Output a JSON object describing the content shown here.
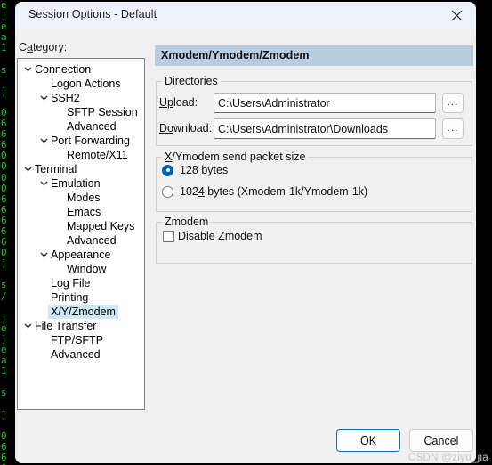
{
  "window": {
    "title": "Session Options - Default",
    "close_icon": "close-icon"
  },
  "category": {
    "label_pre": "C",
    "label_accel": "a",
    "label_post": "tegory:",
    "tree": [
      {
        "label": "Connection",
        "indent": 0,
        "expander": "chevron-down",
        "selected": false
      },
      {
        "label": "Logon Actions",
        "indent": 1,
        "expander": "none",
        "selected": false
      },
      {
        "label": "SSH2",
        "indent": 1,
        "expander": "chevron-down",
        "selected": false
      },
      {
        "label": "SFTP Session",
        "indent": 2,
        "expander": "none",
        "selected": false
      },
      {
        "label": "Advanced",
        "indent": 2,
        "expander": "none",
        "selected": false
      },
      {
        "label": "Port Forwarding",
        "indent": 1,
        "expander": "chevron-down",
        "selected": false
      },
      {
        "label": "Remote/X11",
        "indent": 2,
        "expander": "none",
        "selected": false
      },
      {
        "label": "Terminal",
        "indent": 0,
        "expander": "chevron-down",
        "selected": false
      },
      {
        "label": "Emulation",
        "indent": 1,
        "expander": "chevron-down",
        "selected": false
      },
      {
        "label": "Modes",
        "indent": 2,
        "expander": "none",
        "selected": false
      },
      {
        "label": "Emacs",
        "indent": 2,
        "expander": "none",
        "selected": false
      },
      {
        "label": "Mapped Keys",
        "indent": 2,
        "expander": "none",
        "selected": false
      },
      {
        "label": "Advanced",
        "indent": 2,
        "expander": "none",
        "selected": false
      },
      {
        "label": "Appearance",
        "indent": 1,
        "expander": "chevron-down",
        "selected": false
      },
      {
        "label": "Window",
        "indent": 2,
        "expander": "none",
        "selected": false
      },
      {
        "label": "Log File",
        "indent": 1,
        "expander": "none",
        "selected": false
      },
      {
        "label": "Printing",
        "indent": 1,
        "expander": "none",
        "selected": false
      },
      {
        "label": "X/Y/Zmodem",
        "indent": 1,
        "expander": "none",
        "selected": true
      },
      {
        "label": "File Transfer",
        "indent": 0,
        "expander": "chevron-down",
        "selected": false
      },
      {
        "label": "FTP/SFTP",
        "indent": 1,
        "expander": "none",
        "selected": false
      },
      {
        "label": "Advanced",
        "indent": 1,
        "expander": "none",
        "selected": false
      }
    ]
  },
  "pane": {
    "header": "Xmodem/Ymodem/Zmodem",
    "directories": {
      "legend_pre": "D",
      "legend_accel": "",
      "legend_text": "irectories",
      "upload_label_pre": "U",
      "upload_label_accel": "p",
      "upload_label_post": "load:",
      "upload_value": "C:\\Users\\Administrator",
      "download_label_pre": "D",
      "download_label_accel": "o",
      "download_label_post": "wnload:",
      "download_value": "C:\\Users\\Administrator\\Downloads",
      "browse_label": "..."
    },
    "packet_size": {
      "legend_accel": "X",
      "legend_post": "/Ymodem send packet size",
      "options": [
        {
          "pre": "12",
          "accel": "8",
          "post": " bytes",
          "selected": true
        },
        {
          "pre": "102",
          "accel": "4",
          "post": " bytes  (Xmodem-1k/Ymodem-1k)",
          "selected": false
        }
      ]
    },
    "zmodem": {
      "legend": "Zmodem",
      "checkbox_pre": "Disable ",
      "checkbox_accel": "Z",
      "checkbox_post": "modem",
      "checked": false
    }
  },
  "footer": {
    "ok_label": "OK",
    "cancel_label": "Cancel"
  },
  "watermark": "CSDN @ziyu_jia",
  "terminal": {
    "lines": [
      "e ",
      "]",
      "e",
      "a",
      "1",
      "",
      "s",
      "",
      "]",
      "",
      "0",
      "6",
      "6",
      "6",
      "0",
      "0",
      "0",
      "0",
      "6",
      "6",
      "6",
      "6",
      "6",
      "0",
      "]",
      "",
      "s",
      "/",
      "",
      "]"
    ]
  },
  "colors": {
    "accent": "#0063b1",
    "header_band": "#b9cde0",
    "selection": "#cde8f7",
    "dialog_bg": "#f0f0f0",
    "titlebar_bg": "#eef3fa",
    "terminal_fg": "#1ad01a",
    "terminal_bg": "#000000"
  }
}
